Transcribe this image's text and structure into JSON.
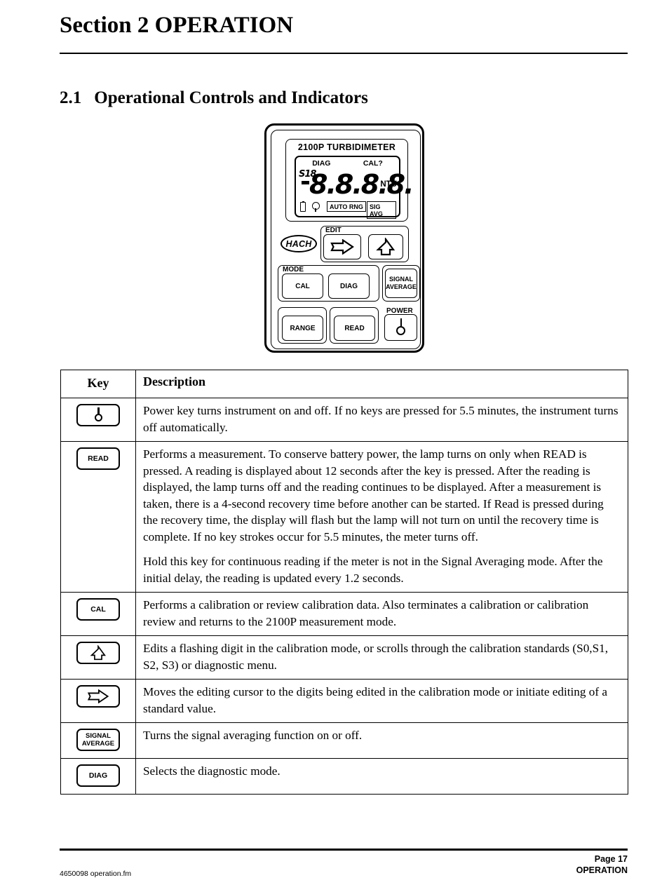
{
  "heading": {
    "section": "Section 2 OPERATION",
    "subsection_number": "2.1",
    "subsection_title": "Operational Controls and Indicators"
  },
  "instrument": {
    "brand_line": "2100P TURBIDIMETER",
    "display": {
      "diag_label": "DIAG",
      "cal_label": "CAL?",
      "standard_indicator": "S18",
      "digits": "8.8.8.8.",
      "units": "NTU",
      "battery_icon": "battery-icon",
      "lamp_icon": "lamp-icon",
      "auto_range_tag": "AUTO RNG",
      "signal_average_tag": "SIG AVG"
    },
    "logo": "HACH",
    "groups": {
      "edit_label": "EDIT",
      "mode_label": "MODE",
      "power_label": "POWER"
    },
    "keys": {
      "edit_right": "right-arrow-icon",
      "edit_up": "up-arrow-icon",
      "cal": "CAL",
      "diag": "DIAG",
      "signal_average": "SIGNAL AVERAGE",
      "signal_average_line1": "SIGNAL",
      "signal_average_line2": "AVERAGE",
      "range": "RANGE",
      "read": "READ",
      "power": "power-symbol-icon"
    }
  },
  "table": {
    "headers": {
      "key": "Key",
      "description": "Description"
    },
    "rows": [
      {
        "key_label": "power-symbol-icon",
        "key_type": "power",
        "paragraphs": [
          "Power key turns instrument on and off. If no keys are pressed for 5.5 minutes, the instrument turns off automatically."
        ]
      },
      {
        "key_label": "READ",
        "key_type": "text",
        "paragraphs": [
          "Performs a measurement. To conserve battery power, the lamp turns on only when READ is pressed. A reading is displayed about 12 seconds after the key is pressed. After the reading is displayed, the lamp turns off and the reading continues to be displayed. After a measurement is taken, there is a 4-second recovery time before another can be started. If Read is pressed during the recovery time, the display will flash but the lamp will not turn on until the recovery time is complete. If no key strokes occur for 5.5 minutes, the meter turns off.",
          "Hold this key for continuous reading if the meter is not in the Signal Averaging mode. After the initial delay, the reading is updated every 1.2 seconds."
        ]
      },
      {
        "key_label": "CAL",
        "key_type": "text",
        "paragraphs": [
          "Performs a calibration or review calibration data. Also terminates a calibration or calibration review and returns to the 2100P measurement mode."
        ]
      },
      {
        "key_label": "up-arrow-icon",
        "key_type": "arrow-up",
        "paragraphs": [
          "Edits a flashing digit in the calibration mode, or scrolls through the calibration standards (S0,S1, S2, S3) or diagnostic menu."
        ]
      },
      {
        "key_label": "right-arrow-icon",
        "key_type": "arrow-right",
        "paragraphs": [
          "Moves the editing cursor to the digits being edited in the calibration mode or initiate editing of a standard value."
        ]
      },
      {
        "key_label": "SIGNAL AVERAGE",
        "key_type": "text2",
        "key_line1": "SIGNAL",
        "key_line2": "AVERAGE",
        "paragraphs": [
          "Turns the signal averaging function on or off."
        ]
      },
      {
        "key_label": "DIAG",
        "key_type": "text",
        "paragraphs": [
          "Selects the diagnostic mode."
        ]
      }
    ]
  },
  "footer": {
    "file": "4650098 operation.fm",
    "page": "Page 17",
    "section": "OPERATION"
  }
}
